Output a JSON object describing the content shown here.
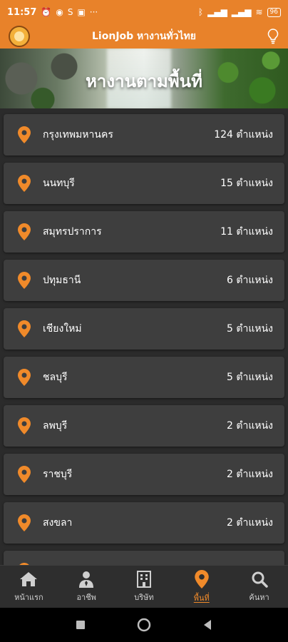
{
  "status_bar": {
    "time": "11:57",
    "left_icons": [
      "alarm-icon",
      "line-icon",
      "s-icon",
      "app-icon",
      "more-icon"
    ],
    "right_icons": [
      "bluetooth-icon",
      "signal-icon",
      "signal-icon",
      "wifi-icon"
    ],
    "battery": "96"
  },
  "app_bar": {
    "title": "LionJob หางานทั่วไทย",
    "accent": "#e8822a"
  },
  "hero": {
    "title": "หางานตามพื้นที่"
  },
  "provinces": [
    {
      "name": "กรุงเทพมหานคร",
      "count": "124 ตำแหน่ง"
    },
    {
      "name": "นนทบุรี",
      "count": "15 ตำแหน่ง"
    },
    {
      "name": "สมุทรปราการ",
      "count": "11 ตำแหน่ง"
    },
    {
      "name": "ปทุมธานี",
      "count": "6 ตำแหน่ง"
    },
    {
      "name": "เชียงใหม่",
      "count": "5 ตำแหน่ง"
    },
    {
      "name": "ชลบุรี",
      "count": "5 ตำแหน่ง"
    },
    {
      "name": "ลพบุรี",
      "count": "2 ตำแหน่ง"
    },
    {
      "name": "ราชบุรี",
      "count": "2 ตำแหน่ง"
    },
    {
      "name": "สงขลา",
      "count": "2 ตำแหน่ง"
    },
    {
      "name": "",
      "count": ""
    }
  ],
  "bottom_nav": [
    {
      "label": "หน้าแรก",
      "icon": "home-icon",
      "active": false
    },
    {
      "label": "อาชีพ",
      "icon": "person-icon",
      "active": false
    },
    {
      "label": "บริษัท",
      "icon": "building-icon",
      "active": false
    },
    {
      "label": "พื้นที่",
      "icon": "location-pin-icon",
      "active": true
    },
    {
      "label": "ค้นหา",
      "icon": "search-icon",
      "active": false
    }
  ],
  "colors": {
    "pin": "#f08a2a",
    "row_bg": "#3e3e3e",
    "background": "#2b2b2b"
  }
}
